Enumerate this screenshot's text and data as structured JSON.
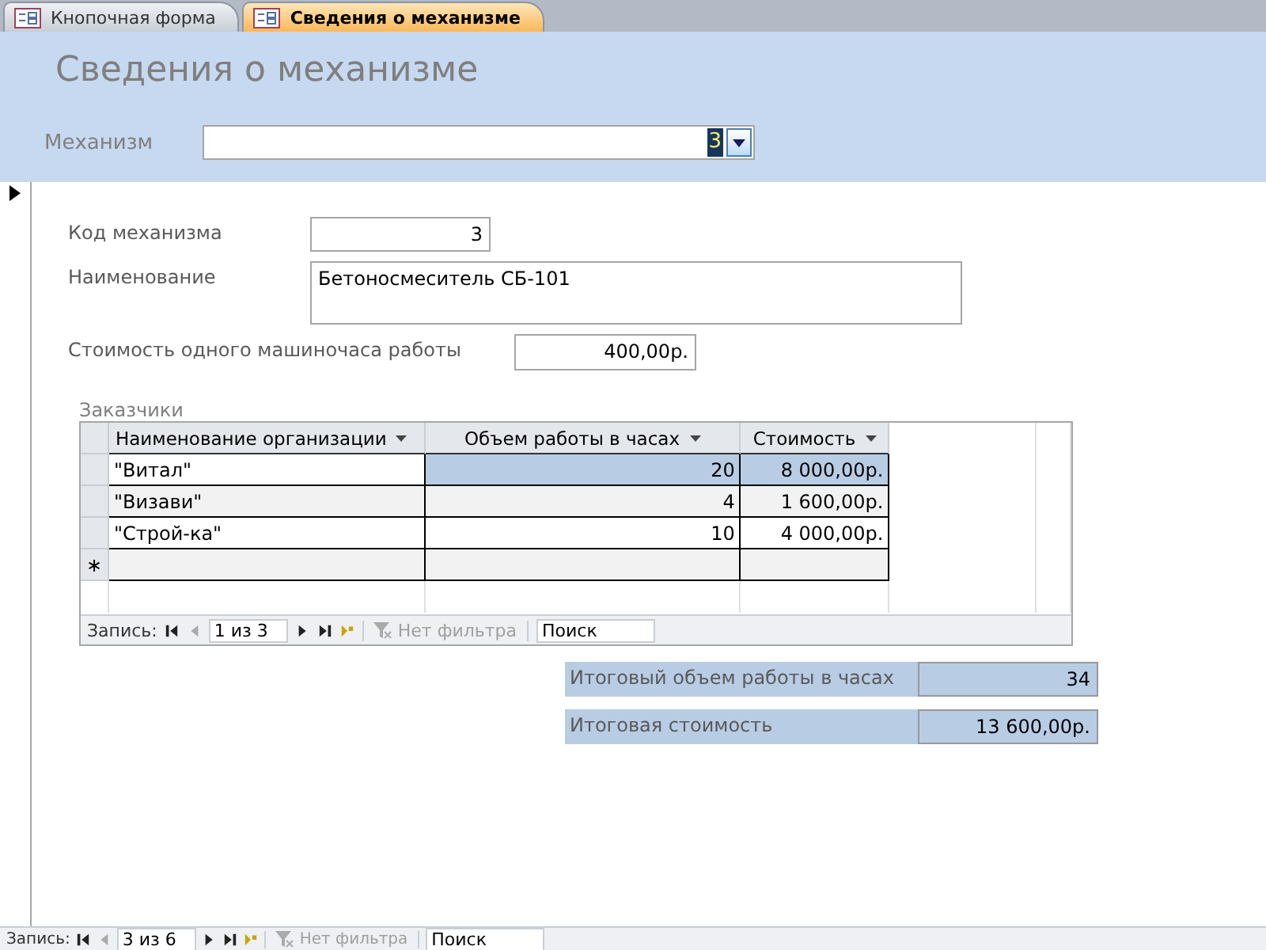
{
  "tabs": [
    {
      "label": "Кнопочная форма",
      "selected": false
    },
    {
      "label": "Сведения о механизме",
      "selected": true
    }
  ],
  "title": "Сведения о механизме",
  "mechanism": {
    "label": "Механизм",
    "value": "3"
  },
  "fields": [
    {
      "kind": "short",
      "label": "Код механизма",
      "value": "3"
    },
    {
      "kind": "long",
      "label": "Наименование",
      "value": "Бетоносмеситель СБ-101"
    },
    {
      "kind": "wide-label",
      "label": "Стоимость одного машиночаса работы",
      "value": "400,00р."
    }
  ],
  "subform": {
    "label": "Заказчики",
    "columns": [
      "Наименование организации",
      "Объем работы в часах",
      "Стоимость"
    ],
    "rows": [
      {
        "cells": [
          {
            "text": "\"Витал\"",
            "selected": false
          },
          {
            "text": "20",
            "selected": true
          },
          {
            "text": "8 000,00р.",
            "selected": true
          }
        ]
      },
      {
        "cells": [
          {
            "text": "\"Визави\"",
            "selected": false
          },
          {
            "text": "4",
            "selected": false
          },
          {
            "text": "1 600,00р.",
            "selected": false
          }
        ]
      },
      {
        "cells": [
          {
            "text": "\"Строй-ка\"",
            "selected": false
          },
          {
            "text": "10",
            "selected": false
          },
          {
            "text": "4 000,00р.",
            "selected": false
          }
        ]
      }
    ],
    "new_row_marker": "∗",
    "nav": {
      "label": "Запись:",
      "position": "1 из 3",
      "filter": "Нет фильтра",
      "search": "Поиск"
    }
  },
  "totals": [
    {
      "label": "Итоговый объем работы в часах",
      "value": "34"
    },
    {
      "label": "Итоговая стоимость",
      "value": "13 600,00р."
    }
  ],
  "nav": {
    "label": "Запись:",
    "position": "3 из 6",
    "filter": "Нет фильтра",
    "search": "Поиск"
  }
}
